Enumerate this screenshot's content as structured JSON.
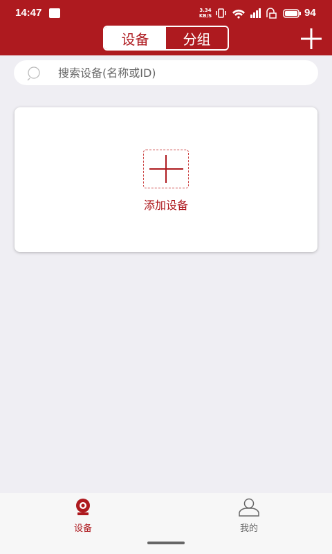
{
  "status_bar": {
    "time": "14:47",
    "net_speed_value": "3.34",
    "net_speed_unit": "KB/S",
    "battery": "94"
  },
  "header": {
    "tabs": [
      {
        "label": "设备",
        "active": true
      },
      {
        "label": "分组",
        "active": false
      }
    ],
    "add_icon": "plus-icon"
  },
  "search": {
    "placeholder": "搜索设备(名称或ID)",
    "value": ""
  },
  "device_list": {
    "add_label": "添加设备"
  },
  "tab_bar": {
    "items": [
      {
        "label": "设备",
        "icon": "camera-icon",
        "active": true
      },
      {
        "label": "我的",
        "icon": "user-icon",
        "active": false
      }
    ]
  },
  "colors": {
    "brand": "#ae1a1f",
    "background": "#efeef3"
  }
}
